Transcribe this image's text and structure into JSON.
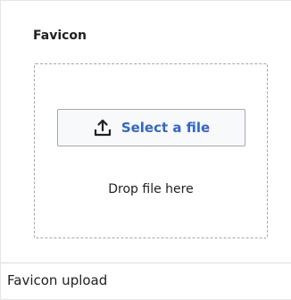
{
  "field": {
    "label": "Favicon"
  },
  "upload": {
    "select_label": "Select a file",
    "drop_text": "Drop file here",
    "icon": "upload-icon"
  },
  "caption": "Favicon upload",
  "colors": {
    "link": "#3366cc",
    "text": "#202122",
    "border": "#a2a9b1",
    "button_bg": "#f8f9fa"
  }
}
